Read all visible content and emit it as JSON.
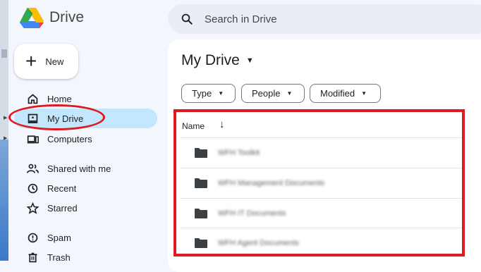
{
  "app": {
    "title": "Drive"
  },
  "search": {
    "placeholder": "Search in Drive"
  },
  "new_button": {
    "label": "New"
  },
  "sidebar": {
    "items": [
      {
        "label": "Home",
        "icon": "home-icon"
      },
      {
        "label": "My Drive",
        "icon": "my-drive-icon",
        "active": true
      },
      {
        "label": "Computers",
        "icon": "computer-icon"
      },
      {
        "label": "Shared with me",
        "icon": "people-icon"
      },
      {
        "label": "Recent",
        "icon": "clock-icon"
      },
      {
        "label": "Starred",
        "icon": "star-icon"
      },
      {
        "label": "Spam",
        "icon": "spam-icon"
      },
      {
        "label": "Trash",
        "icon": "trash-icon"
      }
    ]
  },
  "main": {
    "title": "My Drive",
    "filters": [
      "Type",
      "People",
      "Modified"
    ],
    "columns": {
      "name": "Name"
    },
    "files": [
      {
        "name": "WFH Toolkit",
        "type": "folder"
      },
      {
        "name": "WFH Management Documents",
        "type": "folder"
      },
      {
        "name": "WFH IT Documents",
        "type": "folder"
      },
      {
        "name": "WFH Agent Documents",
        "type": "folder"
      }
    ]
  },
  "colors": {
    "accent_active": "#c2e7ff",
    "page_bg": "#f3f7fd",
    "highlight_red": "#e0191f"
  }
}
